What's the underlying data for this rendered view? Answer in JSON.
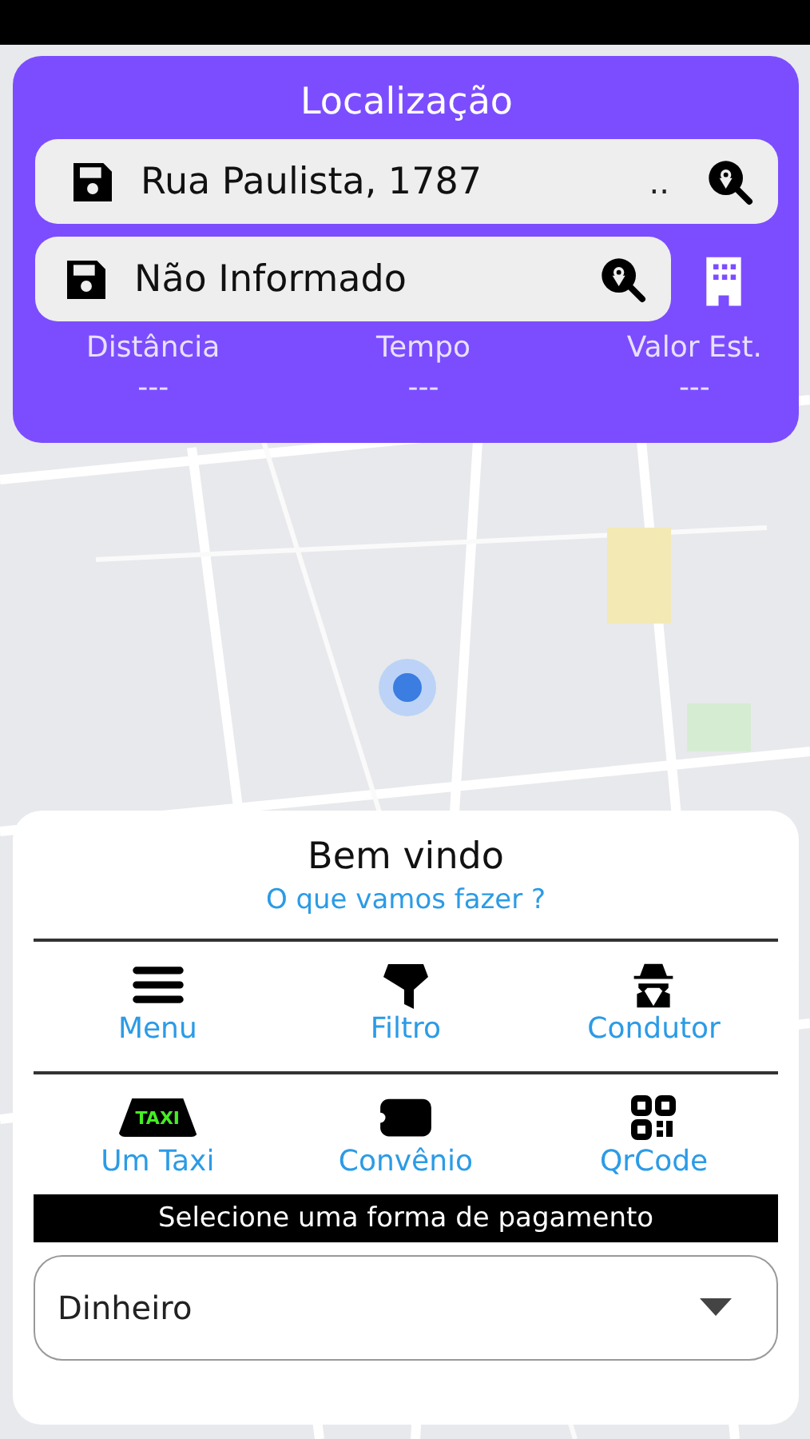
{
  "location": {
    "title": "Localização",
    "origin": {
      "value": "Rua Paulista, 1787",
      "suffix": ".."
    },
    "destination": {
      "value": "Não Informado"
    },
    "stats": [
      {
        "label": "Distância",
        "value": "---"
      },
      {
        "label": "Tempo",
        "value": "---"
      },
      {
        "label": "Valor Est.",
        "value": "---"
      }
    ]
  },
  "panel": {
    "title": "Bem vindo",
    "subtitle": "O que vamos fazer ?",
    "actions": [
      [
        {
          "kind": "menu",
          "label": "Menu"
        },
        {
          "kind": "filter",
          "label": "Filtro"
        },
        {
          "kind": "driver",
          "label": "Condutor"
        }
      ],
      [
        {
          "kind": "taxi",
          "label": "Um Taxi",
          "badge": "TAXI"
        },
        {
          "kind": "ticket",
          "label": "Convênio"
        },
        {
          "kind": "qrcode",
          "label": "QrCode"
        }
      ]
    ],
    "payment": {
      "heading": "Selecione uma forma de pagamento",
      "value": "Dinheiro"
    }
  }
}
